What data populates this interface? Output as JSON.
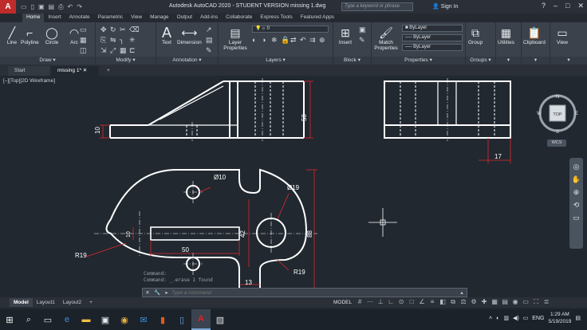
{
  "titlebar": {
    "app_logo": "A",
    "title": "Autodesk AutoCAD 2020 - STUDENT VERSION    missing 1.dwg",
    "search_placeholder": "Type a keyword or phrase",
    "signin_label": "Sign In",
    "minimize": "–",
    "restore": "□",
    "close": "✕"
  },
  "ribbon_tabs": [
    "Home",
    "Insert",
    "Annotate",
    "Parametric",
    "View",
    "Manage",
    "Output",
    "Add-ins",
    "Collaborate",
    "Express Tools",
    "Featured Apps"
  ],
  "ribbon": {
    "draw": {
      "label": "Draw",
      "tools": [
        "Line",
        "Polyline",
        "Circle",
        "Arc"
      ]
    },
    "modify": {
      "label": "Modify"
    },
    "annotation": {
      "label": "Annotation",
      "tools": [
        "Text",
        "Dimension"
      ]
    },
    "layers": {
      "label": "Layers",
      "tool": "Layer Properties",
      "current_layer": "0"
    },
    "block": {
      "label": "Block",
      "tool": "Insert"
    },
    "properties": {
      "label": "Properties",
      "tool": "Match Properties",
      "color": "ByLayer",
      "linetype": "ByLayer",
      "lineweight": "ByLayer"
    },
    "groups": {
      "label": "Groups",
      "tool": "Group"
    },
    "utilities": {
      "label": "Utilities"
    },
    "clipboard": {
      "label": "Clipboard"
    },
    "view": {
      "label": "View"
    }
  },
  "doc_tabs": [
    "Start",
    "missing 1*"
  ],
  "doc_tab_add": "+",
  "viewport_label": "[–][Top][2D Wireframe]",
  "viewcube": {
    "top": "TOP",
    "n": "N",
    "s": "S",
    "e": "E",
    "w": "W",
    "wcs": "WCS"
  },
  "dimensions": {
    "d10_height": "10",
    "d50_height": "50",
    "d17": "17",
    "dia10": "Ø10",
    "dia19": "Ø19",
    "d10_slot": "10",
    "d42": "42",
    "d88": "88",
    "d50_slot": "50",
    "r19_left": "R19",
    "r19_right": "R19",
    "d13": "13"
  },
  "command": {
    "history_1": "Command:",
    "history_2": "Command: _.erase 1 found",
    "placeholder": "Type a command"
  },
  "layout_tabs": [
    "Model",
    "Layout1",
    "Layout2"
  ],
  "layout_add": "+",
  "status": {
    "model": "MODEL"
  },
  "tray": {
    "lang": "ENG",
    "time": "1:29 AM",
    "date": "5/19/2019"
  },
  "colors": {
    "canvas": "#212830",
    "dimension": "#e0282e",
    "geometry": "#ffffff",
    "ribbon": "#3b424c"
  }
}
